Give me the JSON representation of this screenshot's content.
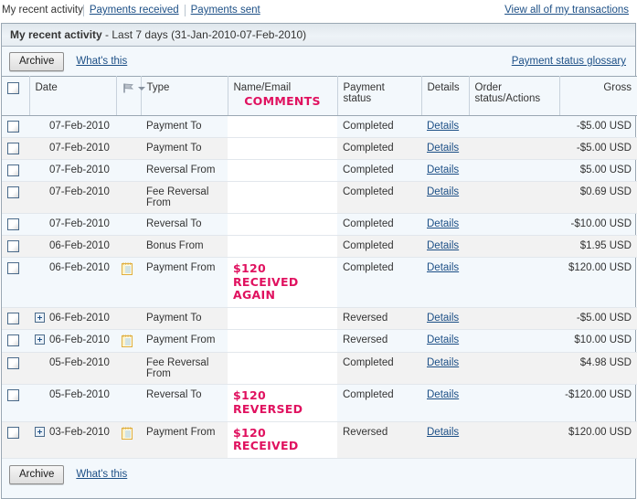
{
  "topnav": {
    "current": "My recent activity",
    "links": [
      "Payments received",
      "Payments sent"
    ],
    "right_link": "View all of my transactions"
  },
  "panel": {
    "title": "My recent activity",
    "subtitle": " - Last 7 days (31-Jan-2010-07-Feb-2010)"
  },
  "toolbar": {
    "archive_label": "Archive",
    "whats_this_label": "What's this",
    "glossary_label": "Payment status glossary"
  },
  "toolbar_bottom": {
    "archive_label": "Archive",
    "whats_this_label": "What's this"
  },
  "table": {
    "headers": {
      "date": "Date",
      "flag": "flag-icon",
      "type": "Type",
      "name": "Name/Email",
      "name_annotation": "COMMENTS",
      "status": "Payment status",
      "details": "Details",
      "order": "Order status/Actions",
      "gross": "Gross"
    },
    "rows": [
      {
        "expand": false,
        "date": "07-Feb-2010",
        "note": false,
        "type": "Payment To",
        "annotation": "",
        "status": "Completed",
        "details": "Details",
        "order": "",
        "gross": "-$5.00 USD"
      },
      {
        "expand": false,
        "date": "07-Feb-2010",
        "note": false,
        "type": "Payment To",
        "annotation": "",
        "status": "Completed",
        "details": "Details",
        "order": "",
        "gross": "-$5.00 USD"
      },
      {
        "expand": false,
        "date": "07-Feb-2010",
        "note": false,
        "type": "Reversal From",
        "annotation": "",
        "status": "Completed",
        "details": "Details",
        "order": "",
        "gross": "$5.00 USD"
      },
      {
        "expand": false,
        "date": "07-Feb-2010",
        "note": false,
        "type": "Fee Reversal From",
        "annotation": "",
        "status": "Completed",
        "details": "Details",
        "order": "",
        "gross": "$0.69 USD"
      },
      {
        "expand": false,
        "date": "07-Feb-2010",
        "note": false,
        "type": "Reversal To",
        "annotation": "",
        "status": "Completed",
        "details": "Details",
        "order": "",
        "gross": "-$10.00 USD"
      },
      {
        "expand": false,
        "date": "06-Feb-2010",
        "note": false,
        "type": "Bonus From",
        "annotation": "",
        "status": "Completed",
        "details": "Details",
        "order": "",
        "gross": "$1.95 USD"
      },
      {
        "expand": false,
        "date": "06-Feb-2010",
        "note": true,
        "type": "Payment From",
        "annotation": "$120 RECEIVED AGAIN",
        "status": "Completed",
        "details": "Details",
        "order": "",
        "gross": "$120.00 USD"
      },
      {
        "expand": true,
        "date": "06-Feb-2010",
        "note": false,
        "type": "Payment To",
        "annotation": "",
        "status": "Reversed",
        "details": "Details",
        "order": "",
        "gross": "-$5.00 USD"
      },
      {
        "expand": true,
        "date": "06-Feb-2010",
        "note": true,
        "type": "Payment From",
        "annotation": "",
        "status": "Reversed",
        "details": "Details",
        "order": "",
        "gross": "$10.00 USD"
      },
      {
        "expand": false,
        "date": "05-Feb-2010",
        "note": false,
        "type": "Fee Reversal From",
        "annotation": "",
        "status": "Completed",
        "details": "Details",
        "order": "",
        "gross": "$4.98 USD"
      },
      {
        "expand": false,
        "date": "05-Feb-2010",
        "note": false,
        "type": "Reversal To",
        "annotation": "$120 REVERSED",
        "status": "Completed",
        "details": "Details",
        "order": "",
        "gross": "-$120.00 USD"
      },
      {
        "expand": true,
        "date": "03-Feb-2010",
        "note": true,
        "type": "Payment From",
        "annotation": "$120 RECEIVED",
        "status": "Reversed",
        "details": "Details",
        "order": "",
        "gross": "$120.00 USD"
      }
    ]
  },
  "colors": {
    "link": "#1c4f86",
    "annotation": "#e0115f",
    "panel_bg": "#f3f8fc",
    "alt_row": "#f2f2f2"
  }
}
